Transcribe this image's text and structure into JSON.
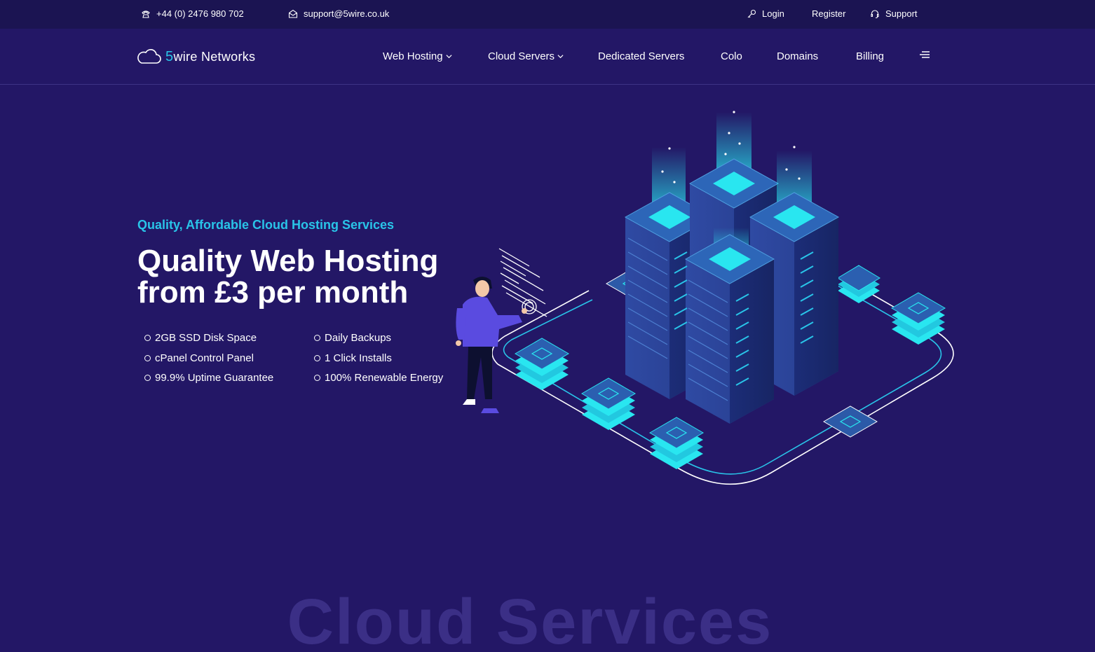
{
  "topbar": {
    "phone": "+44 (0) 2476 980 702",
    "email": "support@5wire.co.uk",
    "login": "Login",
    "register": "Register",
    "support": "Support"
  },
  "brand": {
    "five": "5",
    "rest": "wire Networks"
  },
  "nav": {
    "items": [
      "Web Hosting",
      "Cloud Servers",
      "Dedicated Servers",
      "Colo",
      "Domains",
      "Billing"
    ]
  },
  "hero": {
    "subtitle": "Quality, Affordable Cloud Hosting Services",
    "headline_line1": "Quality Web Hosting",
    "headline_line2": "from £3 per month",
    "features": [
      "2GB SSD Disk Space",
      "cPanel Control Panel",
      "99.9% Uptime Guarantee",
      "Daily Backups",
      "1 Click Installs",
      "100% Renewable Energy"
    ]
  },
  "section": {
    "watermark": "Cloud Services"
  },
  "colors": {
    "background": "#231766",
    "topbar": "#1b1452",
    "accent": "#29c4e8"
  }
}
